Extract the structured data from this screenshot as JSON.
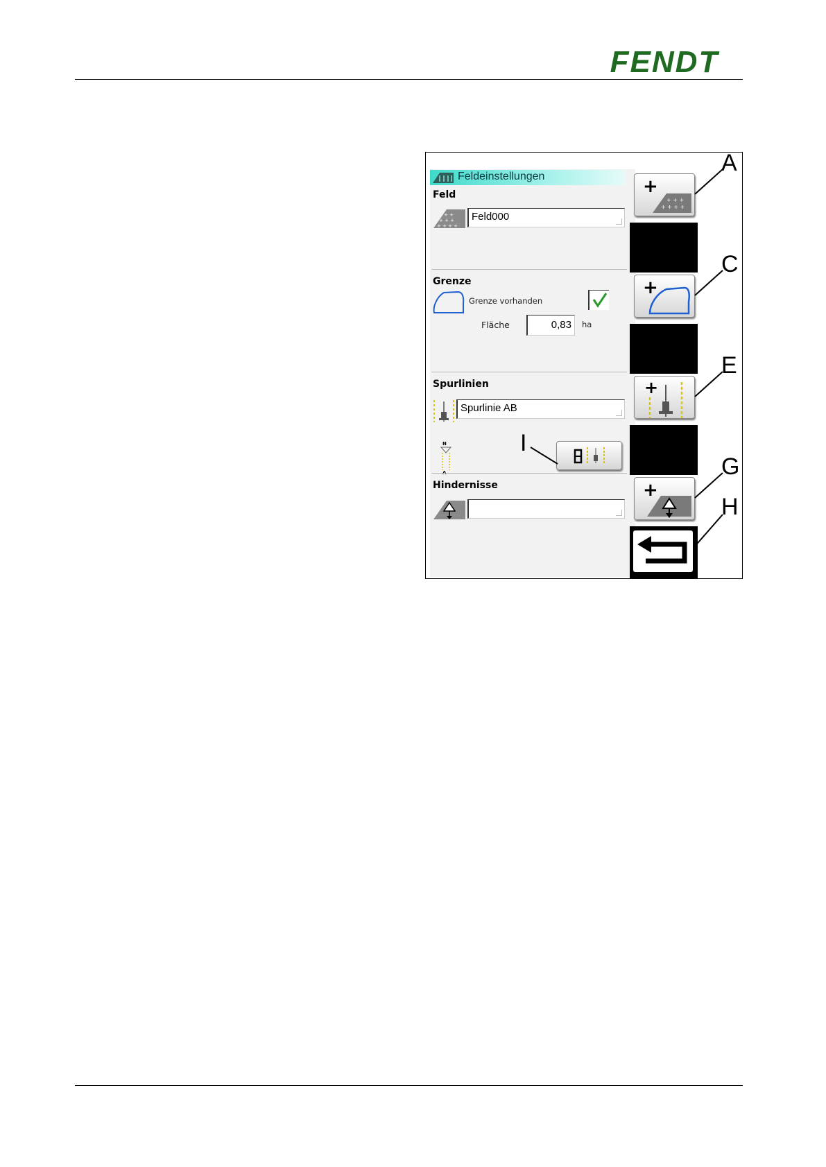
{
  "brand": {
    "logo_text": "FENDT",
    "logo_color": "#1e6a21"
  },
  "screen": {
    "title": "Feldeinstellungen",
    "feld": {
      "label": "Feld",
      "value": "Feld000"
    },
    "grenze": {
      "label": "Grenze",
      "checkbox_label": "Grenze vorhanden",
      "checked": true,
      "area_label": "Fläche",
      "area_value": "0,83",
      "area_unit": "ha"
    },
    "spurlinien": {
      "label": "Spurlinien",
      "value": "Spurlinie AB",
      "compass_n": "N",
      "compass_a": "A"
    },
    "hindernisse": {
      "label": "Hindernisse",
      "value": ""
    }
  },
  "callouts": {
    "a": "A",
    "c": "C",
    "e": "E",
    "g": "G",
    "h": "H",
    "i": "I"
  },
  "colors": {
    "title_bar": "#3fd9c9",
    "check": "#2a9a2a",
    "boundary": "#1f5fd0",
    "dashed_lines": "#d6c21a"
  }
}
